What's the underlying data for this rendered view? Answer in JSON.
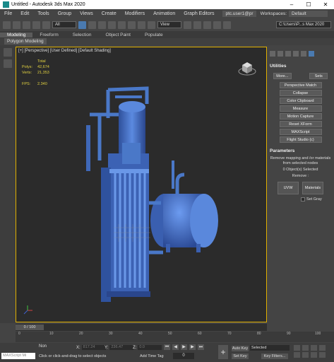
{
  "window": {
    "title": "Untitled - Autodesk 3ds Max 2020",
    "min": "–",
    "max": "☐",
    "close": "✕"
  },
  "menu": {
    "items": [
      "File",
      "Edit",
      "Tools",
      "Group",
      "Views",
      "Create",
      "Modifiers",
      "Animation",
      "Graph Editors"
    ],
    "user": "ptc.user1@pr",
    "workspaces_label": "Workspaces:",
    "workspace": "Default"
  },
  "toolbar": {
    "filter": "All",
    "view": "View",
    "path": "C:\\Users\\P...s Max 2020"
  },
  "ribbon": {
    "tabs": [
      "Modeling",
      "Freeform",
      "Selection",
      "Object Paint",
      "Populate"
    ],
    "sub": "Polygon Modeling"
  },
  "viewport": {
    "label": "[+] [Perspective] [User Defined] [Default Shading]",
    "stats": {
      "total": "Total",
      "polys_label": "Polys:",
      "polys": "42,674",
      "verts_label": "Verts:",
      "verts": "21,353",
      "fps_label": "FPS:",
      "fps": "2.340"
    }
  },
  "utilities": {
    "header": "Utilities",
    "more": "More...",
    "sets": "Sets",
    "buttons": [
      "Perspective Match",
      "Collapse",
      "Color Clipboard",
      "Measure",
      "Motion Capture",
      "Reset XForm",
      "MAXScript",
      "Flight Studio (c)"
    ]
  },
  "parameters": {
    "header": "Parameters",
    "desc": "Remove mapping and /or materials from selected nodes",
    "count": "0 Object(s) Selected",
    "remove": "Remove :",
    "uvw": "UVW",
    "materials": "Materials",
    "setgray": "Set Gray"
  },
  "time": {
    "slider": "0 / 100",
    "ticks": [
      "0",
      "10",
      "20",
      "30",
      "40",
      "50",
      "60",
      "70",
      "80",
      "90",
      "100"
    ]
  },
  "status": {
    "maxscript": "MAXScript Mi",
    "selection": "Non",
    "hint": "Click or click-and-drag to select objects",
    "x_label": "X:",
    "x": "817.24",
    "y_label": "Y:",
    "y": "236.47",
    "z_label": "Z:",
    "z": "0.0",
    "add_time_tag": "Add Time Tag",
    "frame": "0",
    "auto_key": "Auto Key",
    "set_key": "Set Key",
    "selected_mode": "Selected",
    "key_filters": "Key Filters..."
  },
  "colors": {
    "accent": "#e0b000",
    "model": "#4a78c8",
    "bg": "#2b2b2b"
  }
}
